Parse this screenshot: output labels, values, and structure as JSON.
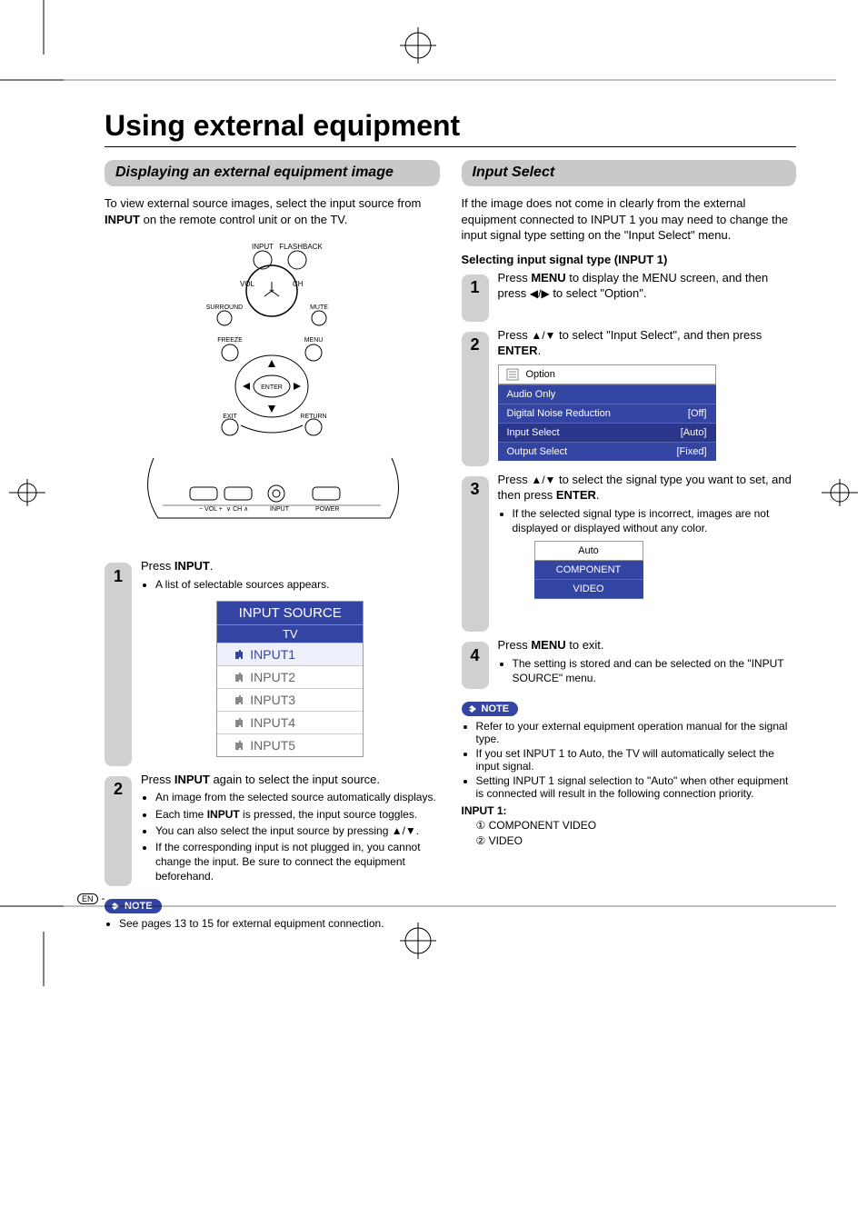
{
  "main_title": "Using external equipment",
  "left": {
    "heading": "Displaying an external equipment image",
    "intro_pre": "To view external source images, select the input source from ",
    "intro_bold": "INPUT",
    "intro_post": " on the remote control unit or on the TV.",
    "step1_num": "1",
    "step1_text_pre": "Press ",
    "step1_text_bold": "INPUT",
    "step1_text_post": ".",
    "step1_bullet1": "A list of selectable sources appears.",
    "input_source": {
      "title": "INPUT SOURCE",
      "tv": "TV",
      "items": [
        "INPUT1",
        "INPUT2",
        "INPUT3",
        "INPUT4",
        "INPUT5"
      ]
    },
    "step2_num": "2",
    "step2_text_pre": "Press ",
    "step2_text_bold": "INPUT",
    "step2_text_post": " again to select the input source.",
    "step2_bullets": [
      "An image from the selected source automatically displays.",
      "Each time INPUT is pressed, the input source toggles.",
      "You can also select the input source by pressing ▲/▼.",
      "If the corresponding input is not plugged in, you cannot change the input. Be sure to connect the equipment beforehand."
    ],
    "note_label": "NOTE",
    "note_bullet": "See pages 13 to 15 for external equipment connection."
  },
  "right": {
    "heading": "Input Select",
    "intro": "If the image does not come in clearly from the external equipment connected to INPUT 1 you may need to change the input signal type setting on the \"Input Select\" menu.",
    "subheading": "Selecting input signal type (INPUT 1)",
    "step1_num": "1",
    "step1_pre": "Press ",
    "step1_bold": "MENU",
    "step1_mid": " to display the MENU screen, and then press ",
    "step1_glyph": "◀/▶",
    "step1_post": " to select \"Option\".",
    "step2_num": "2",
    "step2_pre": "Press ",
    "step2_glyph": "▲/▼",
    "step2_mid": " to select \"Input Select\", and then press ",
    "step2_bold": "ENTER",
    "step2_post": ".",
    "option_menu": {
      "header": "Option",
      "rows": [
        {
          "label": "Audio Only",
          "value": ""
        },
        {
          "label": "Digital Noise Reduction",
          "value": "[Off]"
        },
        {
          "label": "Input Select",
          "value": "[Auto]"
        },
        {
          "label": "Output Select",
          "value": "[Fixed]"
        }
      ]
    },
    "step3_num": "3",
    "step3_pre": "Press ",
    "step3_glyph": "▲/▼",
    "step3_mid": " to select the signal type you want to set, and then press ",
    "step3_bold": "ENTER",
    "step3_post": ".",
    "step3_bullet": "If the selected signal type is incorrect, images are not displayed or displayed without any color.",
    "signal_menu": [
      "Auto",
      "COMPONENT",
      "VIDEO"
    ],
    "step4_num": "4",
    "step4_pre": "Press ",
    "step4_bold": "MENU",
    "step4_post": " to exit.",
    "step4_bullet": "The setting is stored and can be selected on the \"INPUT SOURCE\" menu.",
    "note_label": "NOTE",
    "note_bullets": [
      "Refer to your external equipment operation manual for the signal type.",
      "If you set INPUT 1 to Auto, the TV will automatically select the input signal.",
      "Setting INPUT 1 signal selection to \"Auto\" when other equipment is connected will result in the following connection priority."
    ],
    "priority_label": "INPUT 1:",
    "priority_items": [
      "① COMPONENT VIDEO",
      "② VIDEO"
    ]
  },
  "footer_lang": "EN"
}
